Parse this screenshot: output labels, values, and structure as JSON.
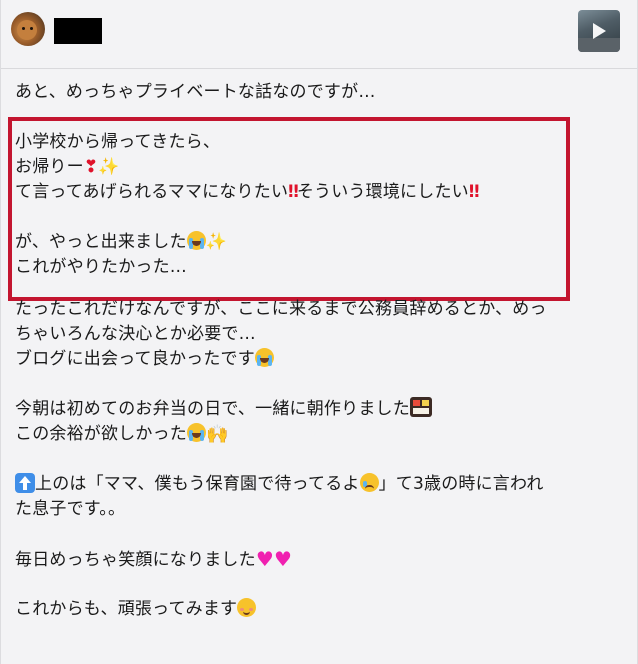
{
  "post": {
    "author": {
      "avatar_icon": "dog-avatar",
      "name_redacted": true
    },
    "media": {
      "thumbnail_icon": "video-thumbnail",
      "play_icon": "play-icon"
    },
    "lines": [
      "あと、めっちゃプライベートな話なのですが…",
      "",
      "小学校から帰ってきたら、",
      "お帰りー",
      "て言ってあげられるママになりたい",
      "そういう環境にしたい",
      "",
      "が、やっと出来ました",
      "これがやりたかった…",
      "たったこれだけなんですが、ここに来るまで公務員辞めるとか、めっ",
      "ちゃいろんな決心とか必要で…",
      "ブログに出会って良かったです",
      "",
      "今朝は初めてのお弁当の日で、一緒に朝作りました",
      "この余裕が欲しかった",
      "",
      "上のは「ママ、僕もう保育園で待ってるよ",
      "」て3歳の時に言われ",
      "た息子です。。",
      "",
      "毎日めっちゃ笑顔になりました",
      "",
      "これからも、頑張ってみます"
    ],
    "emoji": {
      "heart_exclamation": "❣",
      "sparkles": "✨",
      "double_exclamation": "‼",
      "pink_heart": "♥",
      "raising_hands": "🙌"
    },
    "highlight_color": "#c3152f"
  }
}
